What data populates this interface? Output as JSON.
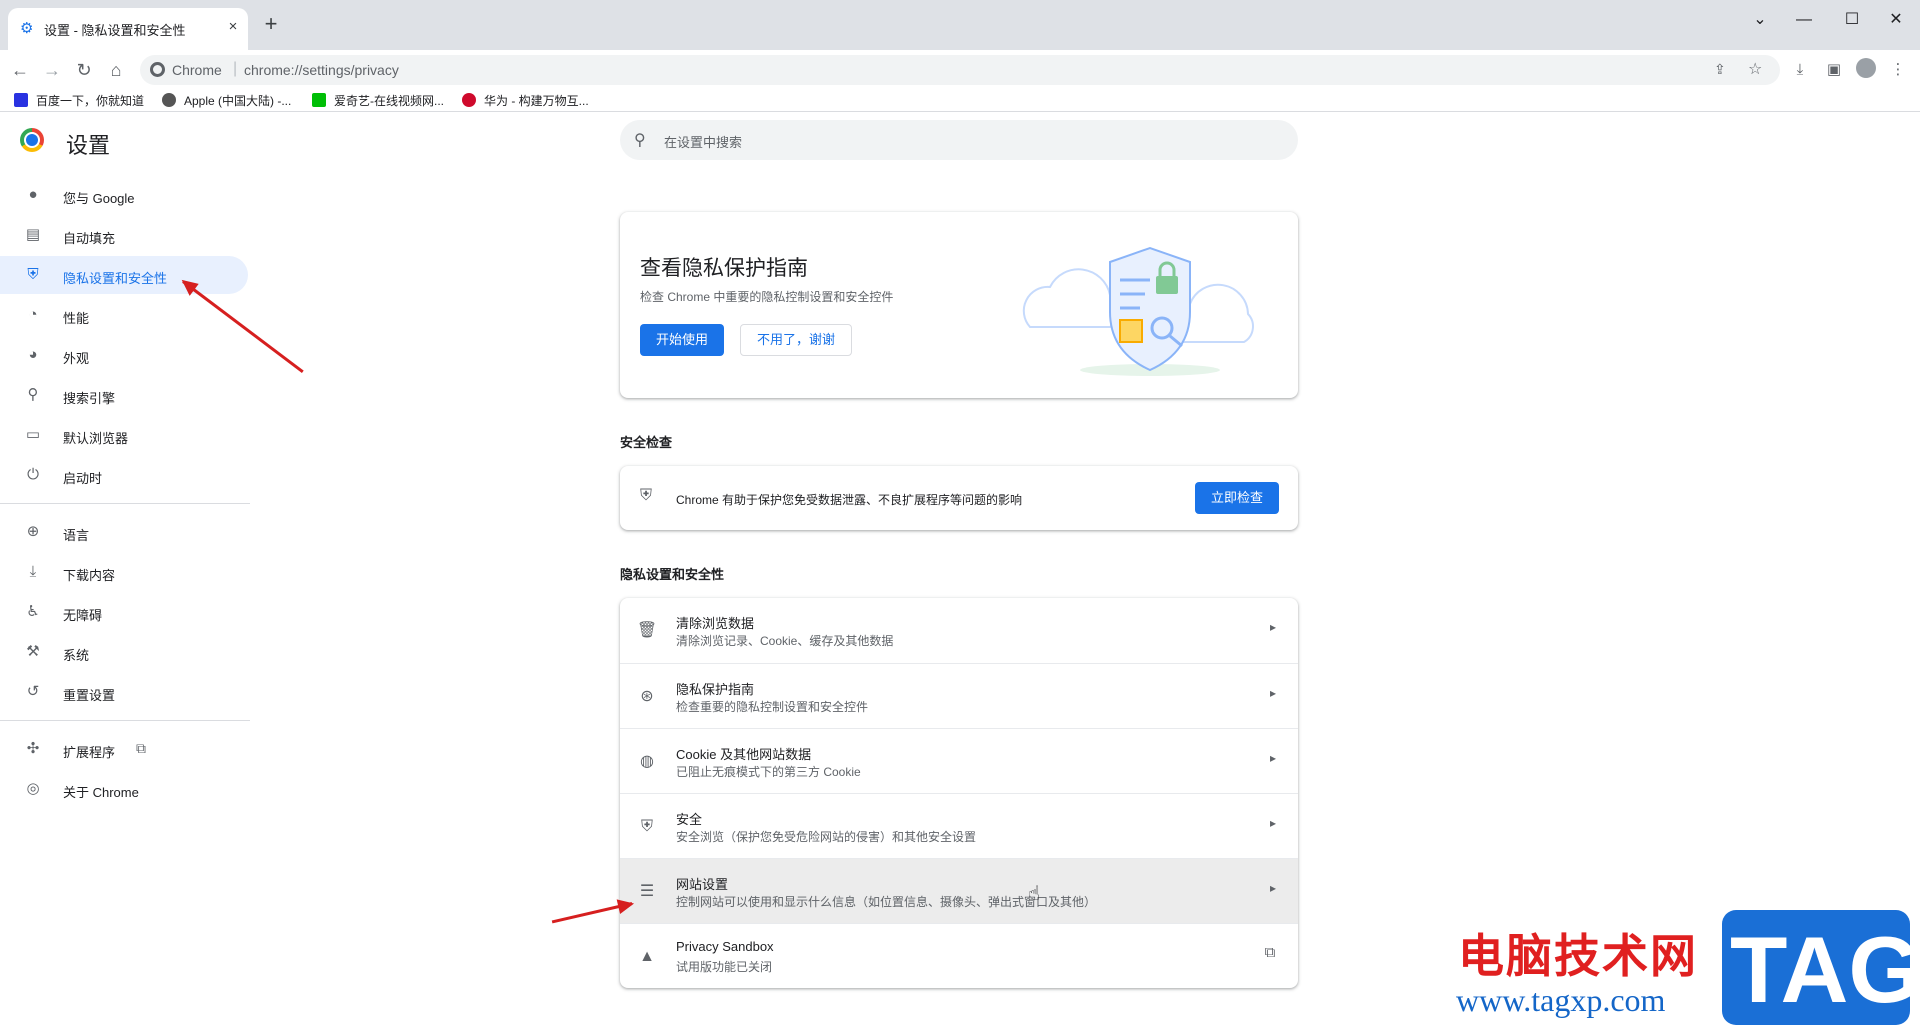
{
  "browser": {
    "tab_title": "设置 - 隐私设置和安全性",
    "close_glyph": "×",
    "newtab_glyph": "+",
    "site_label": "Chrome",
    "url": "chrome://settings/privacy",
    "bookmarks": [
      {
        "label": "百度一下，你就知道",
        "color": "#2932e1"
      },
      {
        "label": "Apple (中国大陆) -...",
        "color": "#555555"
      },
      {
        "label": "爱奇艺-在线视频网...",
        "color": "#00be06"
      },
      {
        "label": "华为 - 构建万物互...",
        "color": "#cf0a2c"
      }
    ]
  },
  "header": {
    "title": "设置",
    "search_placeholder": "在设置中搜索"
  },
  "sidebar": {
    "items": [
      {
        "label": "您与 Google",
        "icon": "person-icon"
      },
      {
        "label": "自动填充",
        "icon": "clipboard-icon"
      },
      {
        "label": "隐私设置和安全性",
        "icon": "shield-icon",
        "active": true
      },
      {
        "label": "性能",
        "icon": "speedometer-icon"
      },
      {
        "label": "外观",
        "icon": "palette-icon"
      },
      {
        "label": "搜索引擎",
        "icon": "search-icon"
      },
      {
        "label": "默认浏览器",
        "icon": "browser-icon"
      },
      {
        "label": "启动时",
        "icon": "power-icon"
      },
      {
        "label": "语言",
        "icon": "globe-icon"
      },
      {
        "label": "下载内容",
        "icon": "download-icon"
      },
      {
        "label": "无障碍",
        "icon": "accessibility-icon"
      },
      {
        "label": "系统",
        "icon": "wrench-icon"
      },
      {
        "label": "重置设置",
        "icon": "history-icon"
      },
      {
        "label": "扩展程序",
        "icon": "puzzle-icon"
      },
      {
        "label": "关于 Chrome",
        "icon": "chrome-icon"
      }
    ]
  },
  "guide_card": {
    "title": "查看隐私保护指南",
    "subtitle": "检查 Chrome 中重要的隐私控制设置和安全控件",
    "start_label": "开始使用",
    "dismiss_label": "不用了，谢谢"
  },
  "safety_check": {
    "section_title": "安全检查",
    "text": "Chrome 有助于保护您免受数据泄露、不良扩展程序等问题的影响",
    "button_label": "立即检查"
  },
  "privacy": {
    "section_title": "隐私设置和安全性",
    "rows": [
      {
        "title": "清除浏览数据",
        "subtitle": "清除浏览记录、Cookie、缓存及其他数据",
        "icon": "trash-icon"
      },
      {
        "title": "隐私保护指南",
        "subtitle": "检查重要的隐私控制设置和安全控件",
        "icon": "compass-icon"
      },
      {
        "title": "Cookie 及其他网站数据",
        "subtitle": "已阻止无痕模式下的第三方 Cookie",
        "icon": "cookie-icon"
      },
      {
        "title": "安全",
        "subtitle": "安全浏览（保护您免受危险网站的侵害）和其他安全设置",
        "icon": "shield-icon"
      },
      {
        "title": "网站设置",
        "subtitle": "控制网站可以使用和显示什么信息（如位置信息、摄像头、弹出式窗口及其他）",
        "icon": "sliders-icon",
        "hover": true
      },
      {
        "title": "Privacy Sandbox",
        "subtitle": "试用版功能已关闭",
        "icon": "flask-icon",
        "external": true
      }
    ]
  },
  "watermark": {
    "cn": "电脑技术网",
    "url": "www.tagxp.com",
    "tag": "TAG"
  },
  "colors": {
    "accent": "#1a73e8",
    "annotation_arrow": "#d61f1f"
  }
}
